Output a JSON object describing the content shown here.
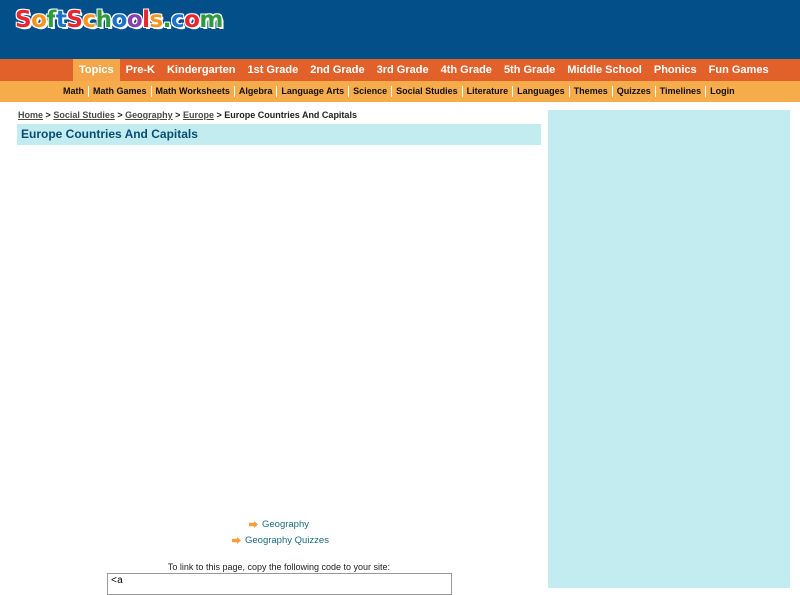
{
  "header": {
    "logo": [
      {
        "text": "S",
        "color": "#e8262d"
      },
      {
        "text": "o",
        "color": "#f7941d"
      },
      {
        "text": "f",
        "color": "#2e9a3e"
      },
      {
        "text": "t",
        "color": "#1a73c9"
      },
      {
        "text": "S",
        "color": "#e8262d"
      },
      {
        "text": "c",
        "color": "#f7941d"
      },
      {
        "text": "h",
        "color": "#2e9a3e"
      },
      {
        "text": "o",
        "color": "#1a73c9"
      },
      {
        "text": "o",
        "color": "#8b3fa8"
      },
      {
        "text": "l",
        "color": "#e8262d"
      },
      {
        "text": "s",
        "color": "#f7941d"
      },
      {
        "text": ".",
        "color": "#2e9a3e"
      },
      {
        "text": "c",
        "color": "#1a73c9"
      },
      {
        "text": "o",
        "color": "#e8262d"
      },
      {
        "text": "m",
        "color": "#2e9a3e"
      }
    ]
  },
  "topnav": {
    "items": [
      "Topics",
      "Pre-K",
      "Kindergarten",
      "1st Grade",
      "2nd Grade",
      "3rd Grade",
      "4th Grade",
      "5th Grade",
      "Middle School",
      "Phonics",
      "Fun Games"
    ],
    "active": "Topics"
  },
  "subnav": {
    "items": [
      "Math",
      "Math Games",
      "Math Worksheets",
      "Algebra",
      "Language Arts",
      "Science",
      "Social Studies",
      "Literature",
      "Languages",
      "Themes",
      "Quizzes",
      "Timelines",
      "Login"
    ]
  },
  "breadcrumb": {
    "links": [
      "Home",
      "Social Studies",
      "Geography",
      "Europe"
    ],
    "separator": ">",
    "current": "Europe Countries And Capitals"
  },
  "page": {
    "title": "Europe Countries And Capitals"
  },
  "related_links": [
    "Geography",
    "Geography Quizzes"
  ],
  "link_to_page": {
    "prompt": "To link to this page, copy the following code to your site:",
    "code": "<a"
  },
  "colors": {
    "header_bg": "#034f8a",
    "nav1_bg": "#e2612a",
    "nav1_active_bg": "#f5a64a",
    "nav2_bg": "#f7ac4c",
    "title_bar_bg": "#c2ecf0",
    "sidebar_bg": "#c2ecf0"
  }
}
